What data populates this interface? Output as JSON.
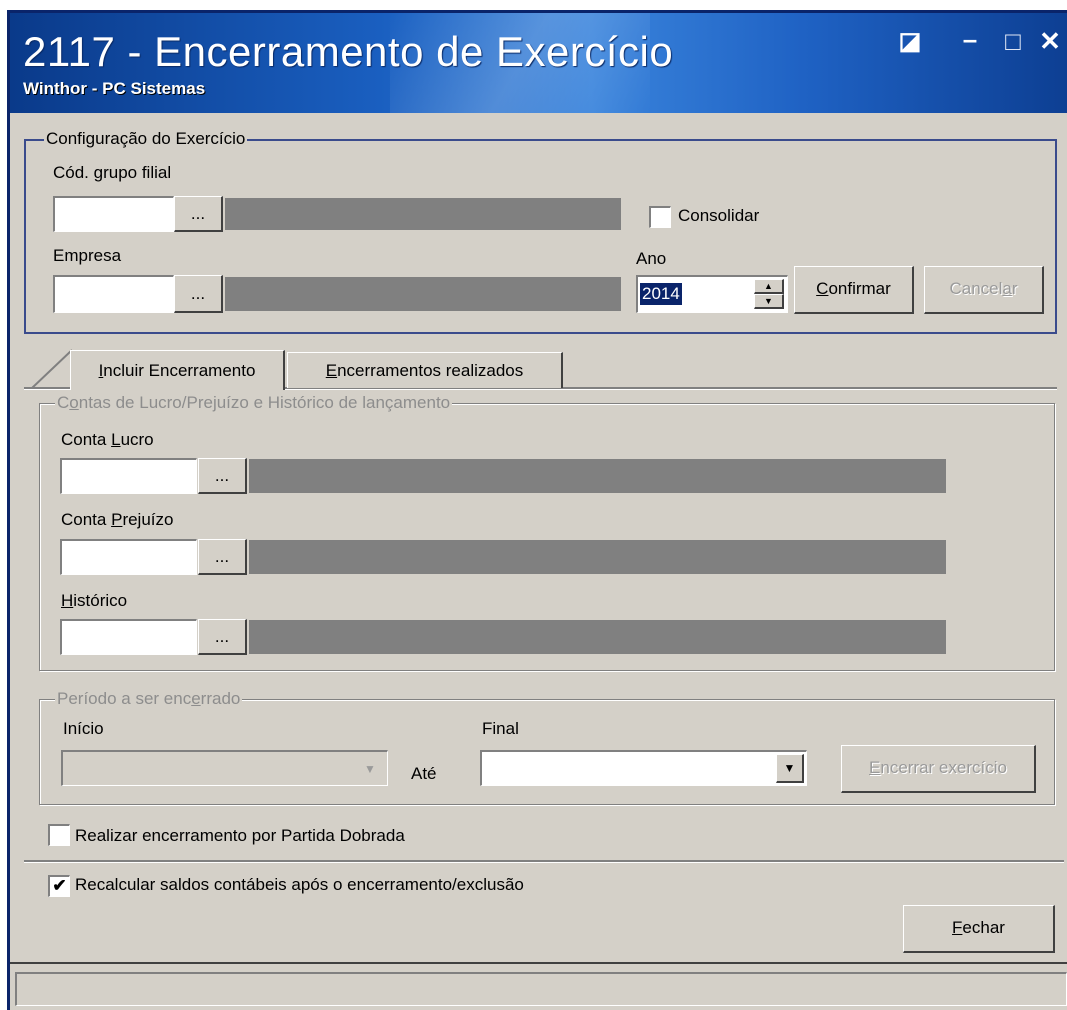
{
  "window": {
    "title": "2117 - Encerramento de Exercício",
    "subtitle": "Winthor - PC Sistemas",
    "buttons": {
      "restore": "◪",
      "minimize": "–",
      "maximize": "□",
      "close": "✕"
    }
  },
  "config": {
    "legend": "Configuração do Exercício",
    "grupo_filial_label": "Cód. grupo filial",
    "grupo_filial_value": "",
    "consolidar_label": "Consolidar",
    "empresa_label": "Empresa",
    "empresa_value": "",
    "ano_label": "Ano",
    "ano_value": "2014",
    "confirmar_label": "Confirmar",
    "cancelar_label": "Cancelar",
    "lookup_label": "..."
  },
  "tabs": [
    {
      "label": "Incluir Encerramento",
      "active": true
    },
    {
      "label": "Encerramentos realizados",
      "active": false
    }
  ],
  "contas": {
    "legend": "Contas de Lucro/Prejuízo e Histórico de lançamento",
    "lucro_label": "Conta Lucro",
    "prejuizo_label": "Conta Prejuízo",
    "historico_label": "Histórico"
  },
  "periodo": {
    "legend": "Período a ser encerrado",
    "inicio_label": "Início",
    "final_label": "Final",
    "ate_label": "Até",
    "encerrar_label": "Encerrar exercício"
  },
  "options": {
    "partida_dobrada_label": "Realizar encerramento por Partida Dobrada",
    "partida_dobrada_checked": false,
    "recalcular_label": "Recalcular saldos contábeis após o encerramento/exclusão",
    "recalcular_checked": true,
    "check_mark": "✔"
  },
  "footer": {
    "fechar_label": "Fechar"
  },
  "colors": {
    "title_blue": "#0a3a8a",
    "window_face": "#d4d0c8",
    "disabled_field": "#808080",
    "selection": "#0a246a"
  }
}
